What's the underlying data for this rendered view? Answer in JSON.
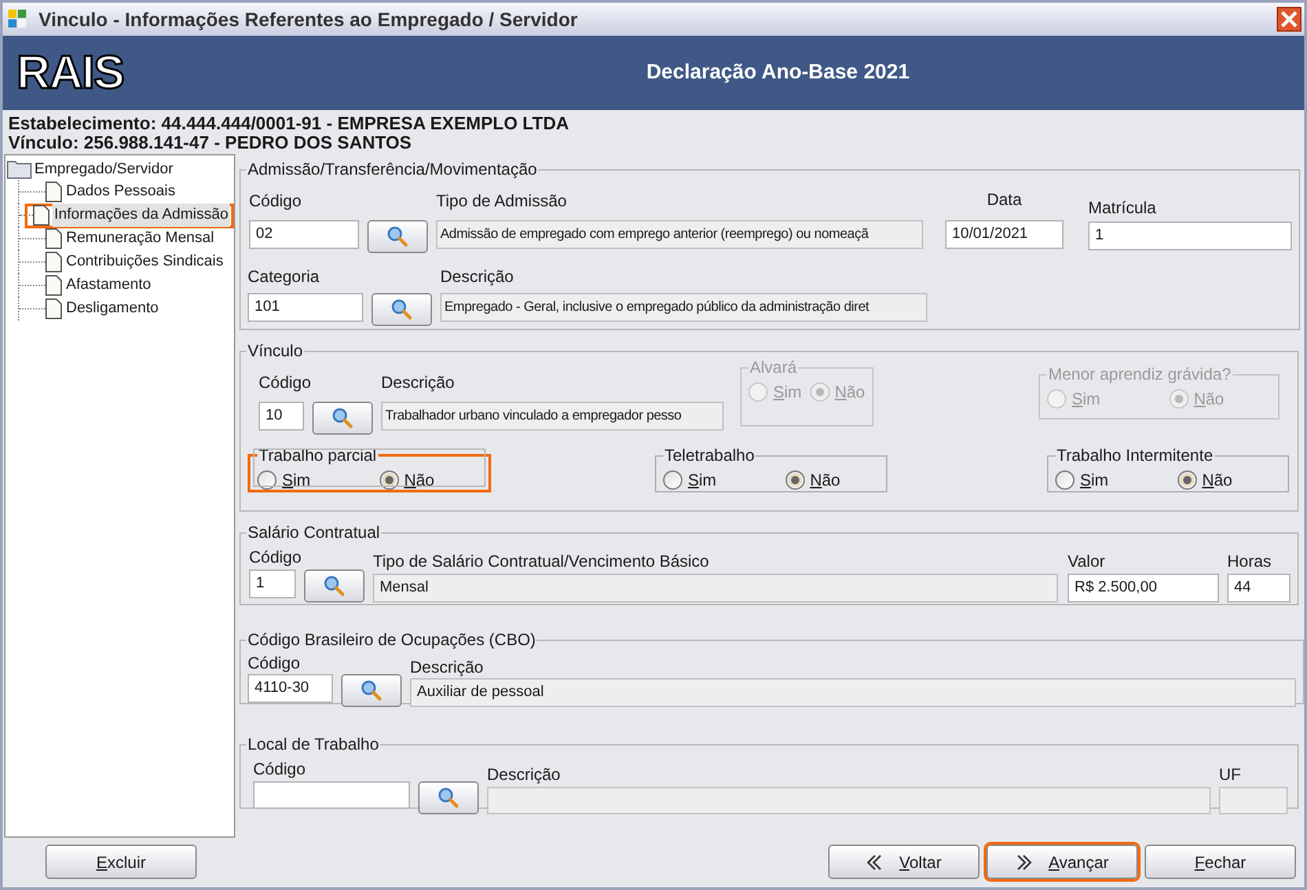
{
  "window": {
    "title": "Vinculo - Informações Referentes ao Empregado / Servidor"
  },
  "header": {
    "logo": "RAIS",
    "title": "Declaração Ano-Base 2021"
  },
  "info": [
    "Estabelecimento: 44.444.444/0001-91 - EMPRESA EXEMPLO LTDA",
    "Vínculo: 256.988.141-47 - PEDRO DOS SANTOS"
  ],
  "tree": {
    "label": "Empregado/Servidor",
    "children": [
      {
        "label": "Dados Pessoais",
        "selected": false
      },
      {
        "label": "Informações da Admissão",
        "selected": true
      },
      {
        "label": "Remuneração Mensal",
        "selected": false
      },
      {
        "label": "Contribuições Sindicais",
        "selected": false
      },
      {
        "label": "Afastamento",
        "selected": false
      },
      {
        "label": "Desligamento",
        "selected": false
      }
    ]
  },
  "admissao": {
    "title": "Admissão/Transferência/Movimentação",
    "codigo_label": "Código",
    "codigo": "02",
    "tipo_label": "Tipo de Admissão",
    "tipo": "Admissão de empregado com emprego anterior (reemprego) ou nomeaçã",
    "data_label": "Data",
    "data": "10/01/2021",
    "matricula_label": "Matrícula",
    "matricula": "1",
    "categoria_label": "Categoria",
    "categoria": "101",
    "descricao_label": "Descrição",
    "descricao": "Empregado - Geral, inclusive o empregado público da administração diret"
  },
  "vinculo": {
    "title": "Vínculo",
    "codigo_label": "Código",
    "codigo": "10",
    "descricao_label": "Descrição",
    "descricao": "Trabalhador urbano vinculado a empregador pesso",
    "radio_groups": [
      {
        "title": "Alvará",
        "disabled": true,
        "highlighted": false,
        "options": [
          {
            "label": "Sim",
            "selected": false
          },
          {
            "label": "Não",
            "selected": true
          }
        ]
      },
      {
        "title": "Menor aprendiz grávida?",
        "disabled": true,
        "highlighted": false,
        "options": [
          {
            "label": "Sim",
            "selected": false
          },
          {
            "label": "Não",
            "selected": true
          }
        ]
      },
      {
        "title": "Trabalho parcial",
        "disabled": false,
        "highlighted": true,
        "options": [
          {
            "label": "Sim",
            "selected": false
          },
          {
            "label": "Não",
            "selected": true
          }
        ]
      },
      {
        "title": "Teletrabalho",
        "disabled": false,
        "highlighted": false,
        "options": [
          {
            "label": "Sim",
            "selected": false
          },
          {
            "label": "Não",
            "selected": true
          }
        ]
      },
      {
        "title": "Trabalho Intermitente",
        "disabled": false,
        "highlighted": false,
        "options": [
          {
            "label": "Sim",
            "selected": false
          },
          {
            "label": "Não",
            "selected": true
          }
        ]
      }
    ]
  },
  "salario": {
    "title": "Salário Contratual",
    "codigo_label": "Código",
    "codigo": "1",
    "tipo_label": "Tipo de Salário Contratual/Vencimento Básico",
    "tipo": "Mensal",
    "valor_label": "Valor",
    "valor": "R$ 2.500,00",
    "horas_label": "Horas",
    "horas": "44"
  },
  "cbo": {
    "title": "Código Brasileiro de Ocupações (CBO)",
    "codigo_label": "Código",
    "codigo": "4110-30",
    "descricao_label": "Descrição",
    "descricao": "Auxiliar de pessoal"
  },
  "local": {
    "title": "Local de Trabalho",
    "codigo_label": "Código",
    "descricao_label": "Descrição",
    "uf_label": "UF"
  },
  "buttons": [
    {
      "label": "Excluir",
      "kind": "plain",
      "highlighted": false
    },
    {
      "label": "Voltar",
      "kind": "back",
      "highlighted": false
    },
    {
      "label": "Avançar",
      "kind": "next",
      "highlighted": true
    },
    {
      "label": "Fechar",
      "kind": "plain",
      "highlighted": false
    }
  ]
}
